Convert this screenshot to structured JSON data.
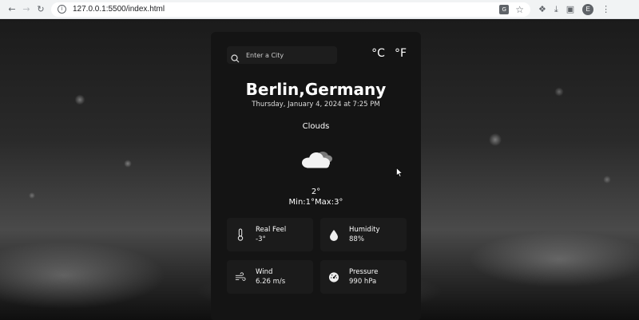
{
  "browser": {
    "url": "127.0.0.1:5500/index.html",
    "profile_initial": "E"
  },
  "app": {
    "search_placeholder": "Enter a City",
    "unit_celsius": "°C",
    "unit_fahrenheit": "°F",
    "city": "Berlin,Germany",
    "datetime": "Thursday, January 4, 2024 at 7:25 PM",
    "condition": "Clouds",
    "condition_icon": "cloud-icon",
    "temperature": "2°",
    "minmax": "Min:1°Max:3°",
    "details": [
      {
        "label": "Real Feel",
        "value": "-3°",
        "icon": "thermometer-icon"
      },
      {
        "label": "Humidity",
        "value": "88%",
        "icon": "droplet-icon"
      },
      {
        "label": "Wind",
        "value": "6.26 m/s",
        "icon": "wind-icon"
      },
      {
        "label": "Pressure",
        "value": "990 hPa",
        "icon": "gauge-icon"
      }
    ]
  }
}
